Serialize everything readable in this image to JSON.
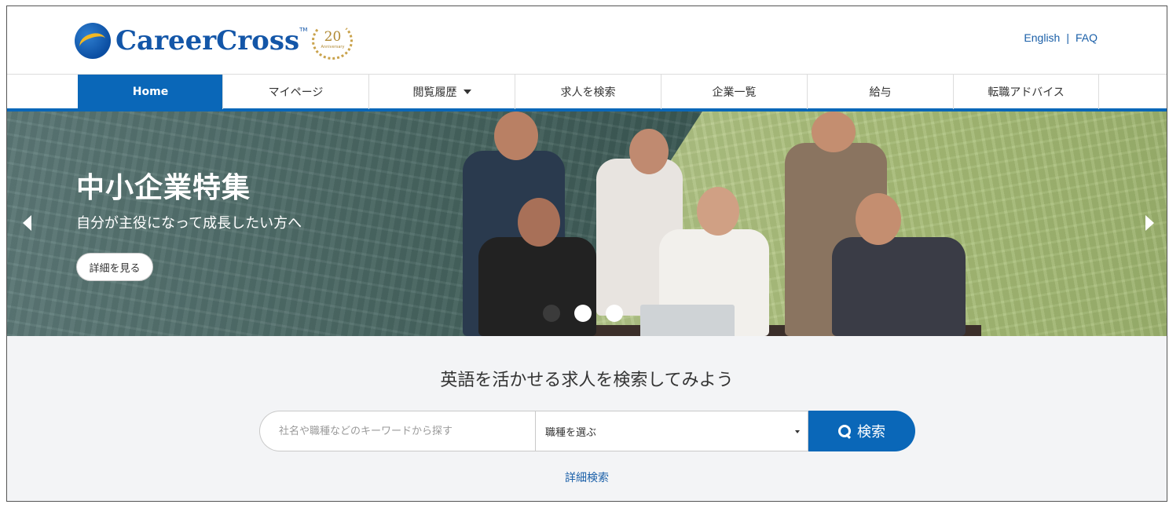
{
  "header": {
    "logo_text": "CareerCross",
    "logo_tm": "TM",
    "anniversary_number": "20",
    "anniversary_sub": "Anniversary",
    "links": {
      "english": "English",
      "separator": "|",
      "faq": "FAQ"
    }
  },
  "nav": {
    "items": [
      {
        "label": "Home",
        "active": true
      },
      {
        "label": "マイページ"
      },
      {
        "label": "閲覧履歴",
        "has_dropdown": true
      },
      {
        "label": "求人を検索"
      },
      {
        "label": "企業一覧"
      },
      {
        "label": "給与"
      },
      {
        "label": "転職アドバイス"
      }
    ]
  },
  "hero": {
    "title": "中小企業特集",
    "subtitle": "自分が主役になって成長したい方へ",
    "button_label": "詳細を見る",
    "slides_total": 3,
    "active_slide": 1
  },
  "search": {
    "heading": "英語を活かせる求人を検索してみよう",
    "keyword_placeholder": "社名や職種などのキーワードから探す",
    "job_select_value": "職種を選ぶ",
    "button_label": "検索",
    "advanced_link": "詳細検索"
  },
  "colors": {
    "brand_blue": "#0a67b8",
    "link_blue": "#1a5fa8",
    "search_bg": "#f3f4f6"
  }
}
